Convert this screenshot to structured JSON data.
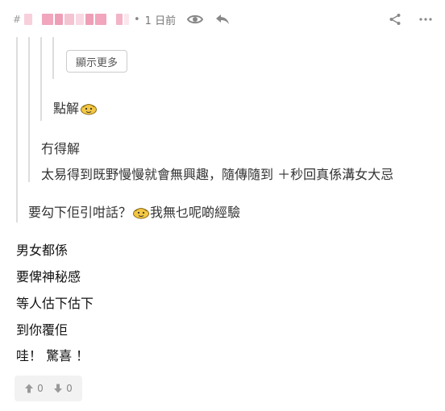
{
  "header": {
    "hash_prefix": "#",
    "separator": "•",
    "time": "1 日前",
    "eye_icon": "eye-icon",
    "reply_icon": "reply-icon",
    "share_icon": "share-icon",
    "more_icon": "more-icon"
  },
  "quotes": {
    "show_more_label": "顯示更多",
    "level3_text": "點解",
    "level2_line1": "冇得解",
    "level2_line2": "太易得到既野慢慢就會無興趣，隨傳隨到 ＋秒回真係溝女大忌",
    "level1_before": "要勾下佢引咁話？",
    "level1_after": "我無乜呢啲經驗"
  },
  "post": {
    "lines": [
      "男女都係",
      "要俾神秘感",
      "等人估下估下",
      "到你覆佢",
      "哇！ 驚喜 ！"
    ]
  },
  "votes": {
    "up_count": "0",
    "down_count": "0"
  },
  "colors": {
    "quote_line": "#dddddd",
    "muted_text": "#777777",
    "vote_bg": "#f2f2f2",
    "emoji_yellow": "#f3c744"
  }
}
